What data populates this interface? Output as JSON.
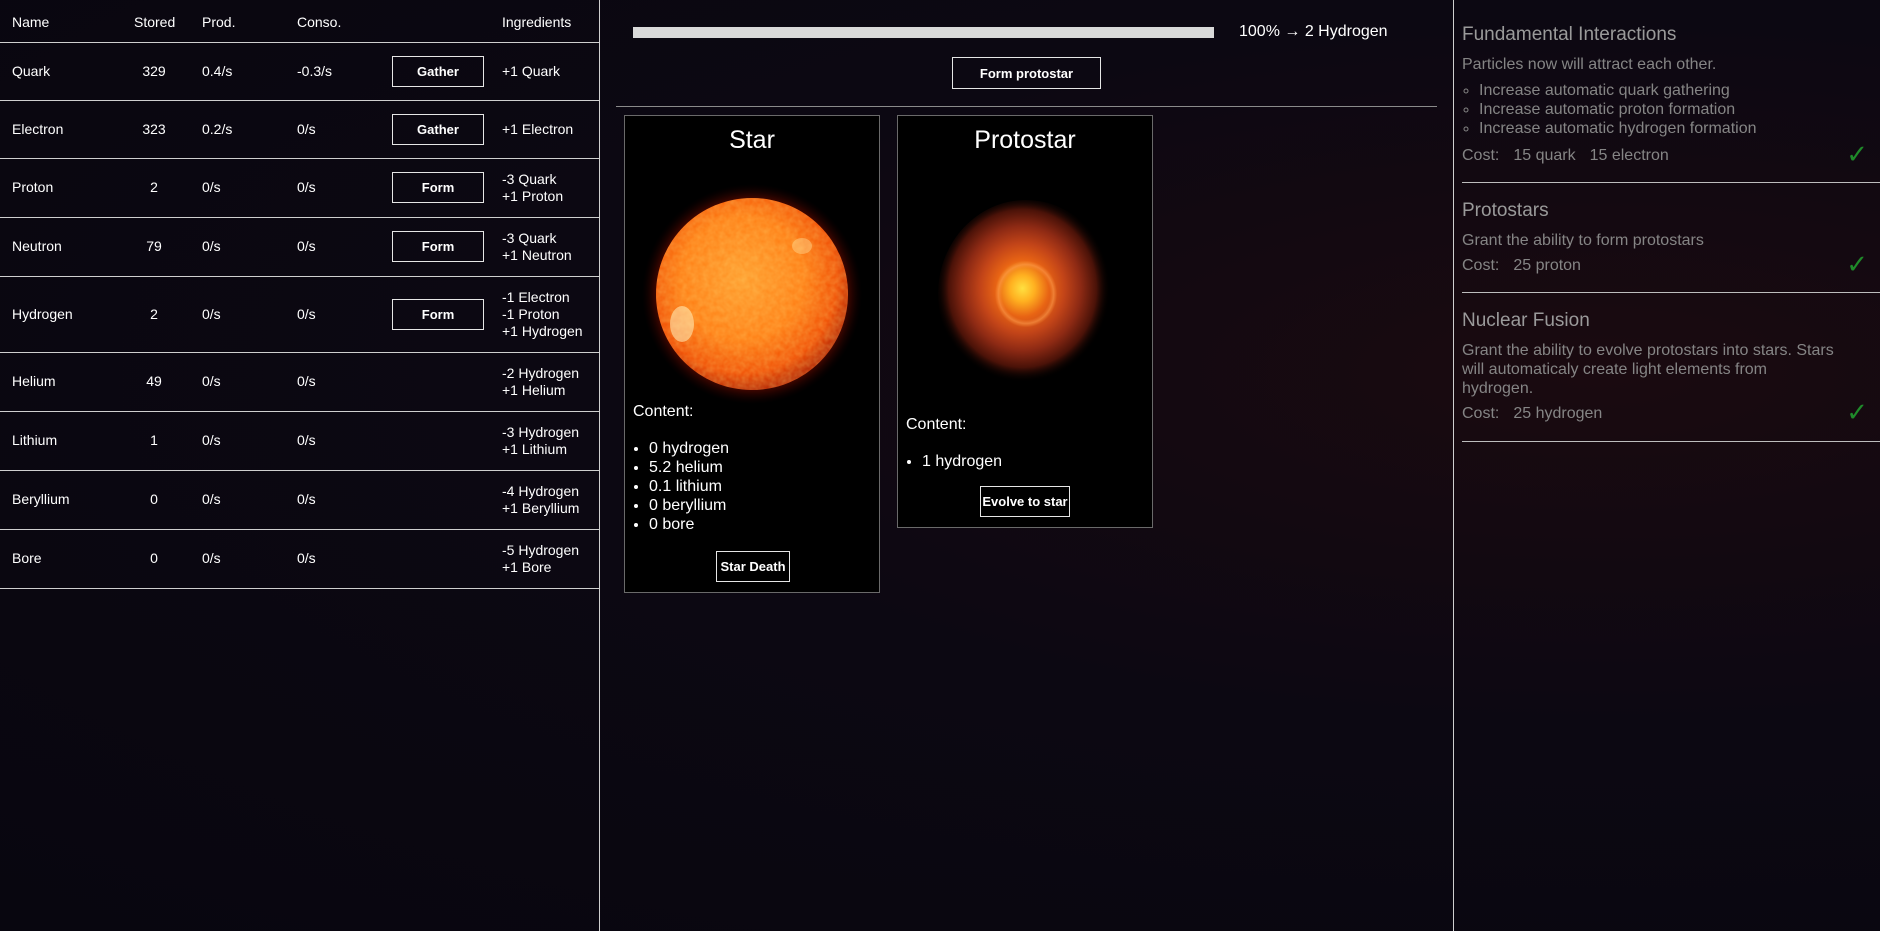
{
  "table": {
    "headers": {
      "name": "Name",
      "stored": "Stored",
      "prod": "Prod.",
      "conso": "Conso.",
      "ingredients": "Ingredients"
    },
    "rows": [
      {
        "name": "Quark",
        "stored": "329",
        "prod": "0.4/s",
        "conso": "-0.3/s",
        "action": "Gather",
        "ingredients": [
          "+1 Quark"
        ]
      },
      {
        "name": "Electron",
        "stored": "323",
        "prod": "0.2/s",
        "conso": "0/s",
        "action": "Gather",
        "ingredients": [
          "+1 Electron"
        ]
      },
      {
        "name": "Proton",
        "stored": "2",
        "prod": "0/s",
        "conso": "0/s",
        "action": "Form",
        "ingredients": [
          "-3 Quark",
          "+1 Proton"
        ]
      },
      {
        "name": "Neutron",
        "stored": "79",
        "prod": "0/s",
        "conso": "0/s",
        "action": "Form",
        "ingredients": [
          "-3 Quark",
          "+1 Neutron"
        ]
      },
      {
        "name": "Hydrogen",
        "stored": "2",
        "prod": "0/s",
        "conso": "0/s",
        "action": "Form",
        "ingredients": [
          "-1 Electron",
          "-1 Proton",
          "+1 Hydrogen"
        ]
      },
      {
        "name": "Helium",
        "stored": "49",
        "prod": "0/s",
        "conso": "0/s",
        "action": "",
        "ingredients": [
          "-2 Hydrogen",
          "+1 Helium"
        ]
      },
      {
        "name": "Lithium",
        "stored": "1",
        "prod": "0/s",
        "conso": "0/s",
        "action": "",
        "ingredients": [
          "-3 Hydrogen",
          "+1 Lithium"
        ]
      },
      {
        "name": "Beryllium",
        "stored": "0",
        "prod": "0/s",
        "conso": "0/s",
        "action": "",
        "ingredients": [
          "-4 Hydrogen",
          "+1 Beryllium"
        ]
      },
      {
        "name": "Bore",
        "stored": "0",
        "prod": "0/s",
        "conso": "0/s",
        "action": "",
        "ingredients": [
          "-5 Hydrogen",
          "+1 Bore"
        ]
      }
    ]
  },
  "progress": {
    "percent": 100,
    "label": "100% → 2 Hydrogen"
  },
  "form_protostar_label": "Form protostar",
  "cards": {
    "star": {
      "title": "Star",
      "content_label": "Content:",
      "content": [
        "0 hydrogen",
        "5.2 helium",
        "0.1 lithium",
        "0 beryllium",
        "0 bore"
      ],
      "button": "Star Death"
    },
    "protostar": {
      "title": "Protostar",
      "content_label": "Content:",
      "content": [
        "1 hydrogen"
      ],
      "button": "Evolve to star"
    }
  },
  "upgrades": [
    {
      "title": "Fundamental Interactions",
      "desc": "Particles now will attract each other.",
      "items": [
        "Increase automatic quark gathering",
        "Increase automatic proton formation",
        "Increase automatic hydrogen formation"
      ],
      "cost_label": "Cost:",
      "costs": [
        "15 quark",
        "15 electron"
      ],
      "check": "✓"
    },
    {
      "title": "Protostars",
      "desc": "Grant the ability to form protostars",
      "items": [],
      "cost_label": "Cost:",
      "costs": [
        "25 proton"
      ],
      "check": "✓"
    },
    {
      "title": "Nuclear Fusion",
      "desc": "Grant the ability to evolve protostars into stars. Stars will automaticaly create light elements from hydrogen.",
      "items": [],
      "cost_label": "Cost:",
      "costs": [
        "25 hydrogen"
      ],
      "check": "✓"
    }
  ],
  "colors": {
    "check": "#1f8a2a",
    "progress_fill": "#d9d9d9"
  }
}
